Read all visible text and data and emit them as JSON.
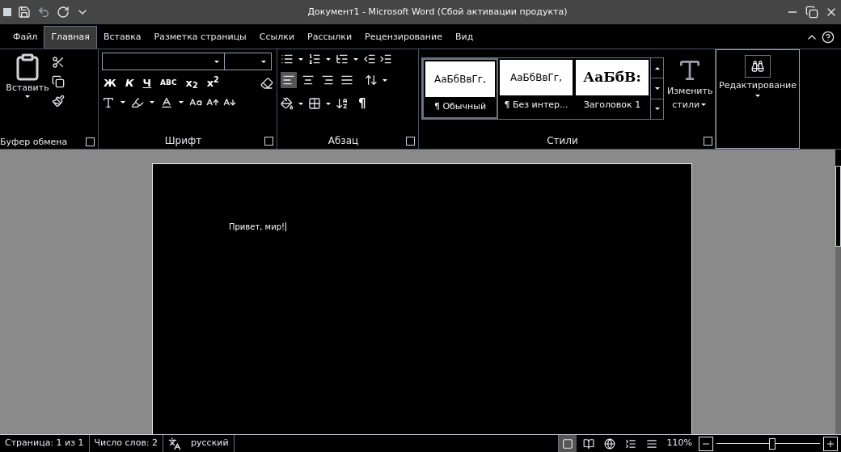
{
  "window": {
    "title": "Документ1 - Microsoft Word (Сбой активации продукта)"
  },
  "tabs": [
    {
      "label": "Файл",
      "selected": false
    },
    {
      "label": "Главная",
      "selected": true
    },
    {
      "label": "Вставка",
      "selected": false
    },
    {
      "label": "Разметка страницы",
      "selected": false
    },
    {
      "label": "Ссылки",
      "selected": false
    },
    {
      "label": "Рассылки",
      "selected": false
    },
    {
      "label": "Рецензирование",
      "selected": false
    },
    {
      "label": "Вид",
      "selected": false
    }
  ],
  "ribbon": {
    "clipboard": {
      "paste_label": "Вставить",
      "group_label": "Буфер обмена"
    },
    "font": {
      "format_buttons": [
        "Ж",
        "К",
        "Ч",
        "ABC",
        "x$_{2}$",
        "x$^{2}$"
      ],
      "group_label": "Шрифт"
    },
    "paragraph": {
      "align_buttons": [
        {
          "selected": true
        },
        {
          "selected": false
        },
        {
          "selected": false
        },
        {
          "selected": false
        }
      ],
      "pilcrow": "¶",
      "group_label": "Абзац"
    },
    "styles": {
      "items": [
        {
          "preview": "АаБбВвГг,",
          "name": "¶ Обычный",
          "selected": true,
          "kind": "sans"
        },
        {
          "preview": "АаБбВвГг,",
          "name": "¶ Без интер...",
          "selected": false,
          "kind": "sans"
        },
        {
          "preview": "АаБбВ:",
          "name": "Заголовок 1",
          "selected": false,
          "kind": "heading"
        }
      ],
      "change_styles_label": [
        "Изменить",
        "стили"
      ],
      "group_label": "Стили"
    },
    "editing": {
      "label": "Редактирование"
    }
  },
  "document": {
    "text": "Привет, мир!"
  },
  "status_bar": {
    "items": [
      "Страница: 1 из 1",
      "Число слов: 2"
    ],
    "language": "русский",
    "views": [
      {
        "selected": true
      },
      {
        "selected": false
      },
      {
        "selected": false
      },
      {
        "selected": false
      },
      {
        "selected": false
      }
    ],
    "zoom": "110%",
    "zoom_slider": {
      "level": 0.54
    }
  }
}
